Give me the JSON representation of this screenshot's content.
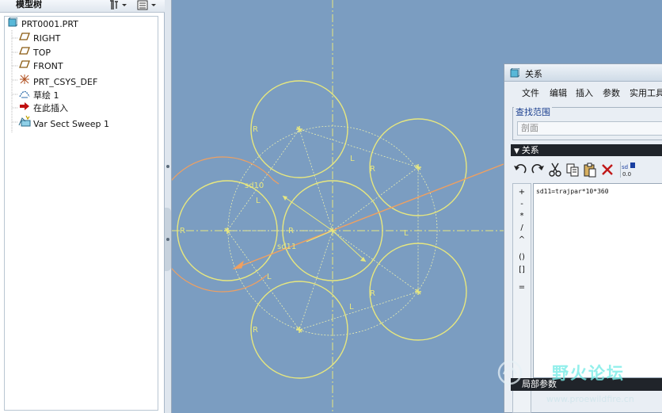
{
  "model_tree": {
    "title": "模型树",
    "settings_icon": "tree-settings-icon",
    "columns_icon": "tree-columns-icon",
    "items": [
      {
        "label": "PRT0001.PRT",
        "icon": "part-icon"
      },
      {
        "label": "RIGHT",
        "icon": "datum-plane-icon"
      },
      {
        "label": "TOP",
        "icon": "datum-plane-icon"
      },
      {
        "label": "FRONT",
        "icon": "datum-plane-icon"
      },
      {
        "label": "PRT_CSYS_DEF",
        "icon": "csys-icon"
      },
      {
        "label": "草绘 1",
        "icon": "sketch-icon"
      },
      {
        "label": "在此插入",
        "icon": "insert-arrow-icon"
      },
      {
        "label": "Var Sect Sweep 1",
        "icon": "sweep-icon"
      }
    ]
  },
  "sketch": {
    "labels": {
      "radius": "R",
      "length": "L",
      "sd10": "sd10",
      "sd11": "sd11"
    },
    "colors": {
      "background": "#7b9dc1",
      "geometry": "#e7e77f",
      "highlight": "#f0a060",
      "centerline": "#e7e77f"
    }
  },
  "relations_dialog": {
    "title": "关系",
    "menu": [
      "文件",
      "编辑",
      "插入",
      "参数",
      "实用工具"
    ],
    "scope_label": "查找范围",
    "scope_value": "剖面",
    "section_label": "关系",
    "relation_text": "sd11=trajpar*10*360",
    "operators": [
      "+",
      "-",
      "*",
      "/",
      "^",
      "()",
      "[]",
      "="
    ],
    "local_params_label": "局部参数"
  },
  "watermark": {
    "title": "野火论坛",
    "url": "www.proewildfire.cn"
  }
}
